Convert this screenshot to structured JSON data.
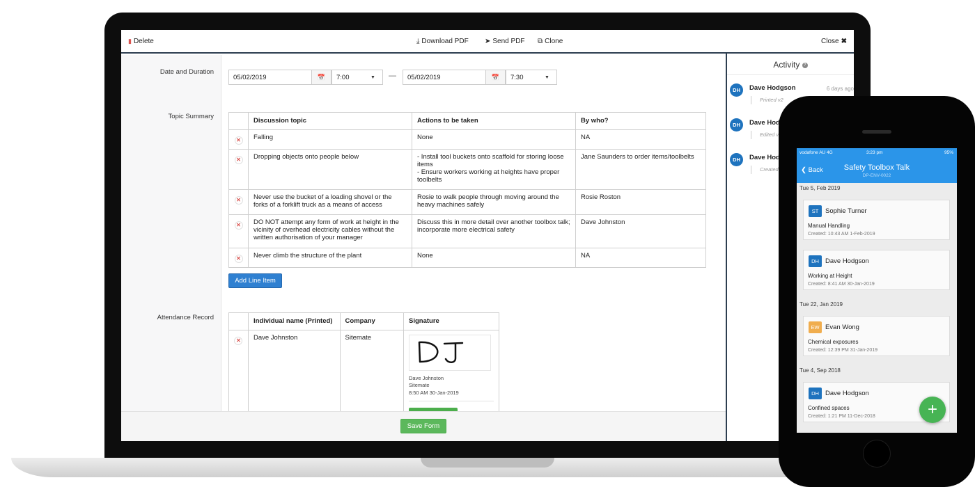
{
  "toolbar": {
    "delete_label": "Delete",
    "download_label": "Download PDF",
    "send_label": "Send PDF",
    "clone_label": "Clone",
    "close_label": "Close"
  },
  "form": {
    "date_label": "Date and Duration",
    "start_date": "05/02/2019",
    "start_time": "7:00",
    "end_date": "05/02/2019",
    "end_time": "7:30",
    "topic_label": "Topic Summary",
    "topic_headers": [
      "Discussion topic",
      "Actions to be taken",
      "By who?"
    ],
    "topic_rows": [
      [
        "Falling",
        "None",
        "NA"
      ],
      [
        "Dropping objects onto people below",
        "- Install tool buckets onto scaffold for storing loose items\n- Ensure workers working at heights have proper toolbelts",
        "Jane Saunders to order items/toolbelts"
      ],
      [
        "Never use the bucket of a loading shovel or the forks of a forklift truck as a means of access",
        "Rosie to walk people through moving around the heavy machines safely",
        "Rosie Roston"
      ],
      [
        "DO NOT attempt any form of work at height in the vicinity of overhead electricity cables without the written authorisation of your manager",
        "Discuss this in more detail over another toolbox talk; incorporate more electrical safety",
        "Dave Johnston"
      ],
      [
        "Never climb the structure of the plant",
        "None",
        "NA"
      ]
    ],
    "add_line_label": "Add Line Item",
    "attendance_label": "Attendance Record",
    "attendance_headers": [
      "Individual name (Printed)",
      "Company",
      "Signature"
    ],
    "attendance_rows": [
      {
        "name": "Dave Johnston",
        "company": "Sitemate",
        "sig_name": "Dave Johnston",
        "sig_company": "Sitemate",
        "sig_time": "8:50 AM 30-Jan-2019"
      }
    ],
    "save_label": "Save Form"
  },
  "activity": {
    "title": "Activity",
    "entries": [
      {
        "initials": "DH",
        "name": "Dave Hodgson",
        "time": "6 days ago",
        "note": "Printed v2"
      },
      {
        "initials": "DH",
        "name": "Dave Hod",
        "time": "",
        "note": "Edited v"
      },
      {
        "initials": "DH",
        "name": "Dave Hod",
        "time": "",
        "note": "Created"
      }
    ]
  },
  "phone": {
    "carrier": "vodafone AU  4G",
    "time": "3:23 pm",
    "battery": "95%",
    "back_label": "Back",
    "title": "Safety Toolbox Talk",
    "subtitle": "DP-ENV-0022",
    "groups": [
      {
        "date": "Tue 5, Feb 2019",
        "cards": [
          {
            "initials": "ST",
            "color": "#1e73be",
            "name": "Sophie Turner",
            "topic": "Manual Handling",
            "created": "Created: 10:43 AM  1-Feb-2019"
          },
          {
            "initials": "DH",
            "color": "#1e73be",
            "name": "Dave Hodgson",
            "topic": "Working at Height",
            "created": "Created: 8:41 AM  30-Jan-2019"
          }
        ]
      },
      {
        "date": "Tue 22, Jan 2019",
        "cards": [
          {
            "initials": "EW",
            "color": "#f0ad4e",
            "name": "Evan  Wong",
            "topic": "Chemical exposures",
            "created": "Created: 12:39 PM  31-Jan-2019"
          }
        ]
      },
      {
        "date": "Tue 4, Sep 2018",
        "cards": [
          {
            "initials": "DH",
            "color": "#1e73be",
            "name": "Dave Hodgson",
            "topic": "Confined spaces",
            "created": "Created: 1:21 PM  11-Dec-2018"
          }
        ]
      }
    ],
    "fab_label": "+"
  }
}
